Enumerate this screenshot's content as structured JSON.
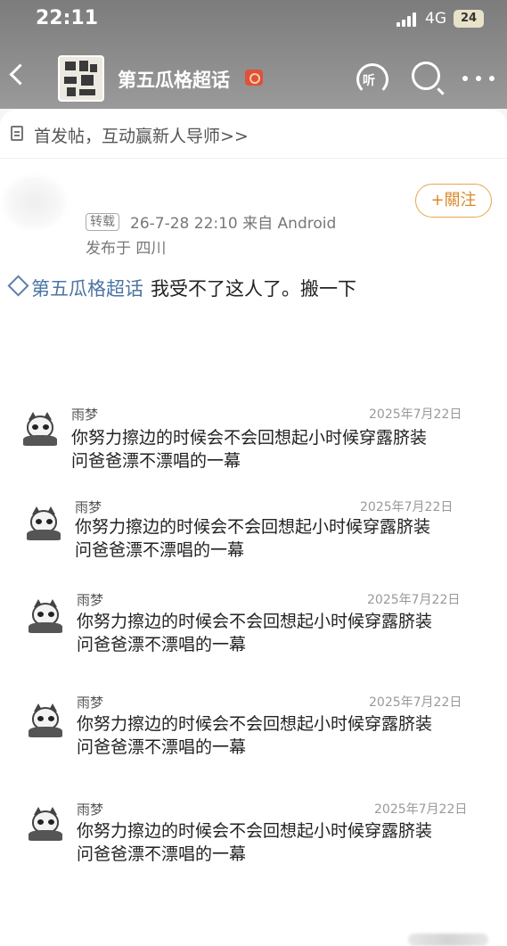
{
  "status_bar": {
    "time": "22:11",
    "network": "4G",
    "battery": "24"
  },
  "nav": {
    "title": "第五瓜格超话",
    "listen_label": "听",
    "icons": [
      "back-icon",
      "group-avatar",
      "hot-badge-icon",
      "listen-icon",
      "search-icon",
      "more-icon"
    ]
  },
  "tip_bar": {
    "text": "首发帖，互动赢新人导师>>"
  },
  "post": {
    "repost_tag": "转载",
    "meta": "26-7-28 22:10  来自 Android",
    "location": "发布于 四川",
    "follow_label": "+關注",
    "topic": "第五瓜格超话",
    "text": "我受不了这人了。搬一下"
  },
  "comments": [
    {
      "name": "雨梦",
      "date": "2025年7月22日",
      "line1": "你努力擦边的时候会不会回想起小时候穿露脐装",
      "line2": "问爸爸漂不漂唱的一幕"
    },
    {
      "name": "雨梦",
      "date": "2025年7月22日",
      "line1": "你努力擦边的时候会不会回想起小时候穿露脐装",
      "line2": "问爸爸漂不漂唱的一幕"
    },
    {
      "name": "雨梦",
      "date": "2025年7月22日",
      "line1": "你努力擦边的时候会不会回想起小时候穿露脐装",
      "line2": "问爸爸漂不漂唱的一幕"
    },
    {
      "name": "雨梦",
      "date": "2025年7月22日",
      "line1": "你努力擦边的时候会不会回想起小时候穿露脐装",
      "line2": "问爸爸漂不漂唱的一幕"
    },
    {
      "name": "雨梦",
      "date": "2025年7月22日",
      "line1": "你努力擦边的时候会不会回想起小时候穿露脐装",
      "line2": "问爸爸漂不漂唱的一幕"
    }
  ],
  "colors": {
    "topic_link": "#4c74a4",
    "follow_accent": "#e8a64a",
    "header_gray": "#8e8e8e"
  }
}
